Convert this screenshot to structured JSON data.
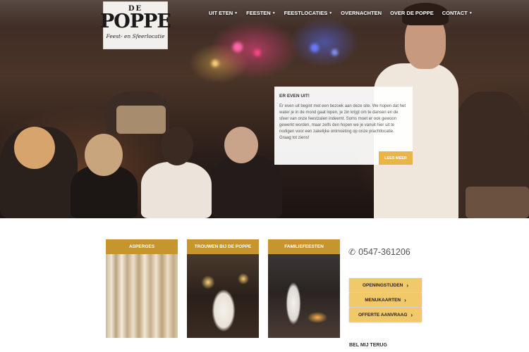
{
  "logo": {
    "top": "DE",
    "name": "POPPE",
    "tagline": "Feest- en Sfeerlocatie"
  },
  "nav": [
    {
      "label": "UIT ETEN",
      "dropdown": true
    },
    {
      "label": "FEESTEN",
      "dropdown": true
    },
    {
      "label": "FEESTLOCATIES",
      "dropdown": true
    },
    {
      "label": "OVERNACHTEN",
      "dropdown": false
    },
    {
      "label": "OVER DE POPPE",
      "dropdown": false
    },
    {
      "label": "CONTACT",
      "dropdown": true
    }
  ],
  "info": {
    "title": "ER EVEN UIT!",
    "text": "Er even uit begint met een bezoek aan deze site. We hopen dat het water je in de mond gaat lopen, je zin krijgt om te dansen en de sfeer van onze feestzalen indeemt. Soms moet er ook gewoon gewerkt worden, maar zelfs den hopen we je vanuit hier uit te nodigen voor een zakelijke ontmoeting op onze prachtlocatie. Graag tot ziens!",
    "button": "LEES MEER"
  },
  "tiles": [
    {
      "label": "ASPERGES"
    },
    {
      "label": "TROUWEN BIJ DE POPPE"
    },
    {
      "label": "FAMILIEFEESTEN"
    }
  ],
  "contact": {
    "phone_icon": "phone-icon",
    "phone": "0547-361206",
    "buttons": [
      {
        "label": "OPENINGSTIJDEN"
      },
      {
        "label": "MENUKAARTEN"
      },
      {
        "label": "OFFERTE AANVRAAG"
      }
    ],
    "callback": "BEL MIJ TERUG"
  },
  "colors": {
    "accent": "#e9b448",
    "tile_label": "#c6952e",
    "button": "#f2c969"
  }
}
